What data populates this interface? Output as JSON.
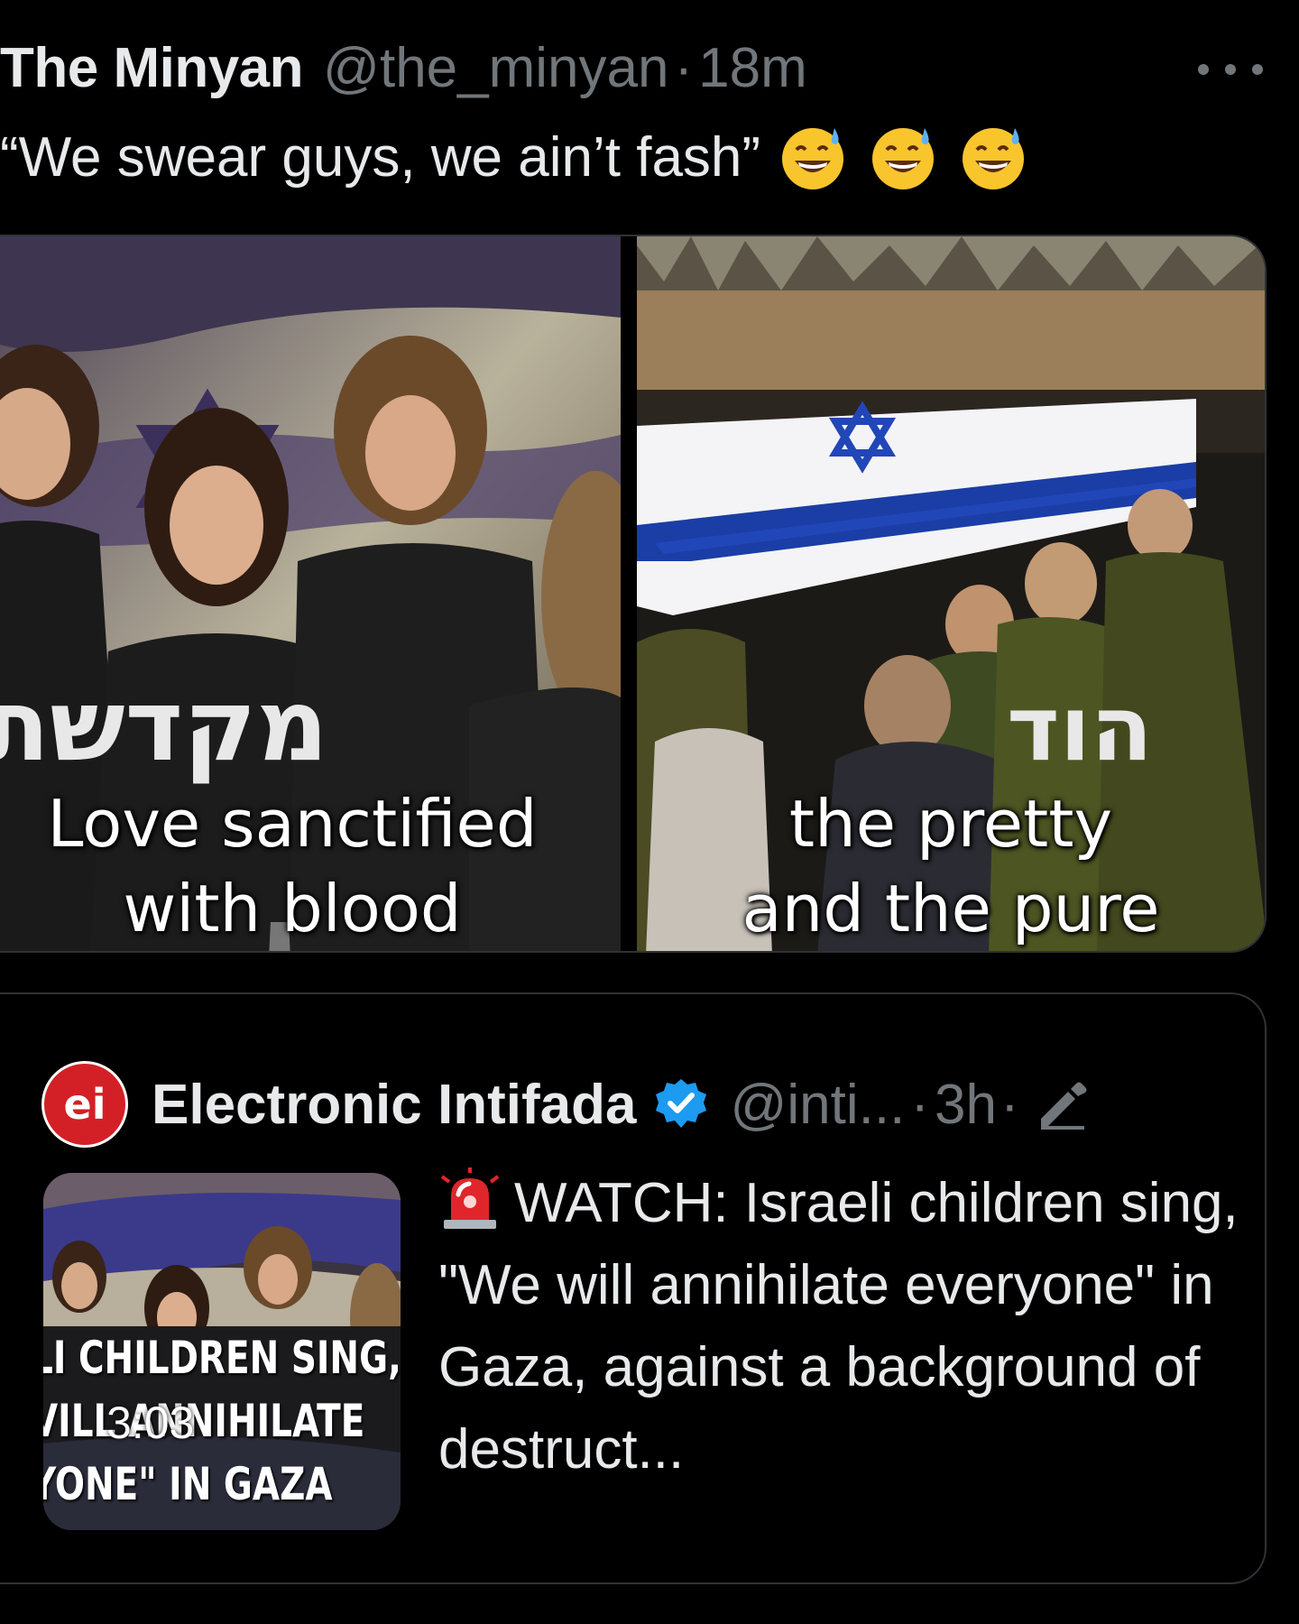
{
  "tweet": {
    "display_name": "The Minyan",
    "handle": "@the_minyan",
    "separator": "·",
    "time": "18m",
    "text": "“We swear guys, we ain’t fash”",
    "emojis": [
      "sweat-smile-emoji",
      "sweat-smile-emoji",
      "sweat-smile-emoji"
    ]
  },
  "media": {
    "left": {
      "caption_line1": "Love sanctified",
      "caption_line2": "with blood",
      "hebrew_overlay": "מקדשת"
    },
    "right": {
      "caption_line1": "the pretty",
      "caption_line2": "and the pure",
      "hebrew_overlay": "הוד"
    }
  },
  "quote": {
    "avatar_text": "ei",
    "display_name": "Electronic Intifada",
    "handle": "@inti...",
    "separator": "·",
    "time": "3h",
    "separator2": "·",
    "thumbnail_overlay": "LI CHILDREN SING,\nVILL ANNIHILATE\nYONE\" IN GAZA",
    "duration": "3:03",
    "text": "WATCH: Israeli children sing, \"We will annihilate everyone\" in Gaza, against a background of destruct..."
  },
  "colors": {
    "background": "#000000",
    "primary_text": "#e7e9ea",
    "secondary_text": "#71767b",
    "border": "#2f3336",
    "verified_blue": "#1d9bf0",
    "ei_red": "#d32026"
  }
}
